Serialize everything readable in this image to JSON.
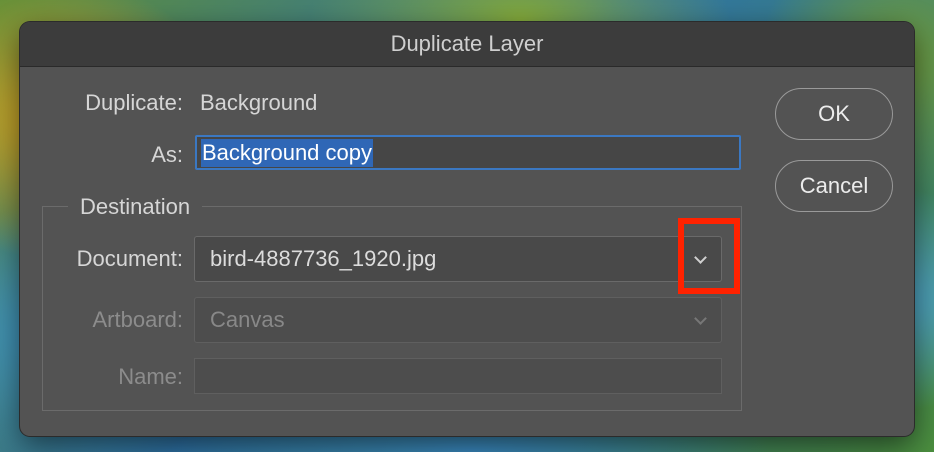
{
  "dialog": {
    "title": "Duplicate Layer",
    "duplicate_label": "Duplicate:",
    "duplicate_value": "Background",
    "as_label": "As:",
    "as_value": "Background copy",
    "destination": {
      "legend": "Destination",
      "document_label": "Document:",
      "document_value": "bird-4887736_1920.jpg",
      "artboard_label": "Artboard:",
      "artboard_value": "Canvas",
      "name_label": "Name:",
      "name_value": ""
    },
    "ok_label": "OK",
    "cancel_label": "Cancel"
  },
  "colors": {
    "dialog_bg": "#535353",
    "titlebar_bg": "#3c3c3c",
    "selection": "#2f67b6",
    "focus_border": "#3b78c2",
    "highlight_box": "#ff2200"
  },
  "icons": {
    "dropdown": "chevron-down-icon"
  }
}
